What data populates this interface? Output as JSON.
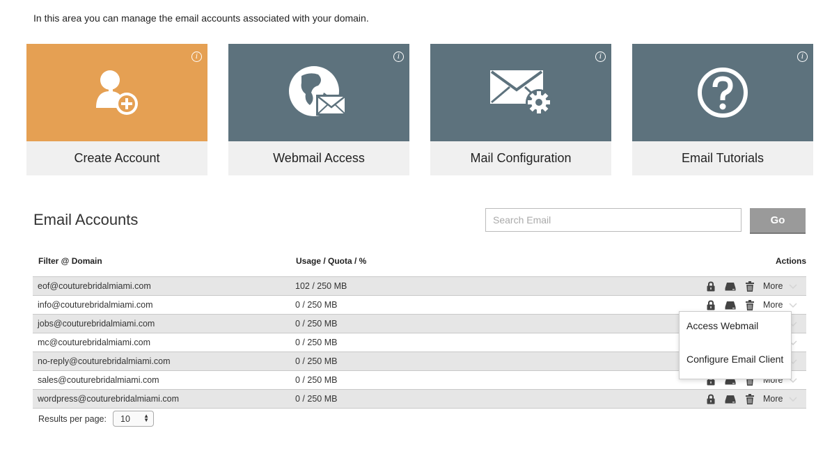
{
  "intro_text": "In this area you can manage the email accounts associated with your domain.",
  "tiles": [
    {
      "label": "Create Account",
      "icon": "add-user-icon",
      "color": "#e5a053"
    },
    {
      "label": "Webmail Access",
      "icon": "globe-mail-icon",
      "color": "#5d727d"
    },
    {
      "label": "Mail Configuration",
      "icon": "mail-gear-icon",
      "color": "#5d727d"
    },
    {
      "label": "Email Tutorials",
      "icon": "question-icon",
      "color": "#5d727d"
    }
  ],
  "info_icon_glyph": "i",
  "section_title": "Email Accounts",
  "search": {
    "placeholder": "Search Email",
    "value": "",
    "button_label": "Go"
  },
  "table": {
    "columns": [
      "Filter @ Domain",
      "Usage / Quota / %",
      "Actions"
    ],
    "rows": [
      {
        "email": "eof@couturebridalmiami.com",
        "usage": "102 / 250 MB"
      },
      {
        "email": "info@couturebridalmiami.com",
        "usage": "0 / 250 MB"
      },
      {
        "email": "jobs@couturebridalmiami.com",
        "usage": "0 / 250 MB"
      },
      {
        "email": "mc@couturebridalmiami.com",
        "usage": "0 / 250 MB"
      },
      {
        "email": "no-reply@couturebridalmiami.com",
        "usage": "0 / 250 MB"
      },
      {
        "email": "sales@couturebridalmiami.com",
        "usage": "0 / 250 MB"
      },
      {
        "email": "wordpress@couturebridalmiami.com",
        "usage": "0 / 250 MB"
      }
    ],
    "action_icons": [
      "lock-icon",
      "drive-icon",
      "trash-icon"
    ],
    "more_label": "More"
  },
  "more_menu": {
    "items": [
      "Access Webmail",
      "Configure Email Client"
    ]
  },
  "pagination": {
    "results_label": "Results per page:",
    "per_page": "10"
  }
}
